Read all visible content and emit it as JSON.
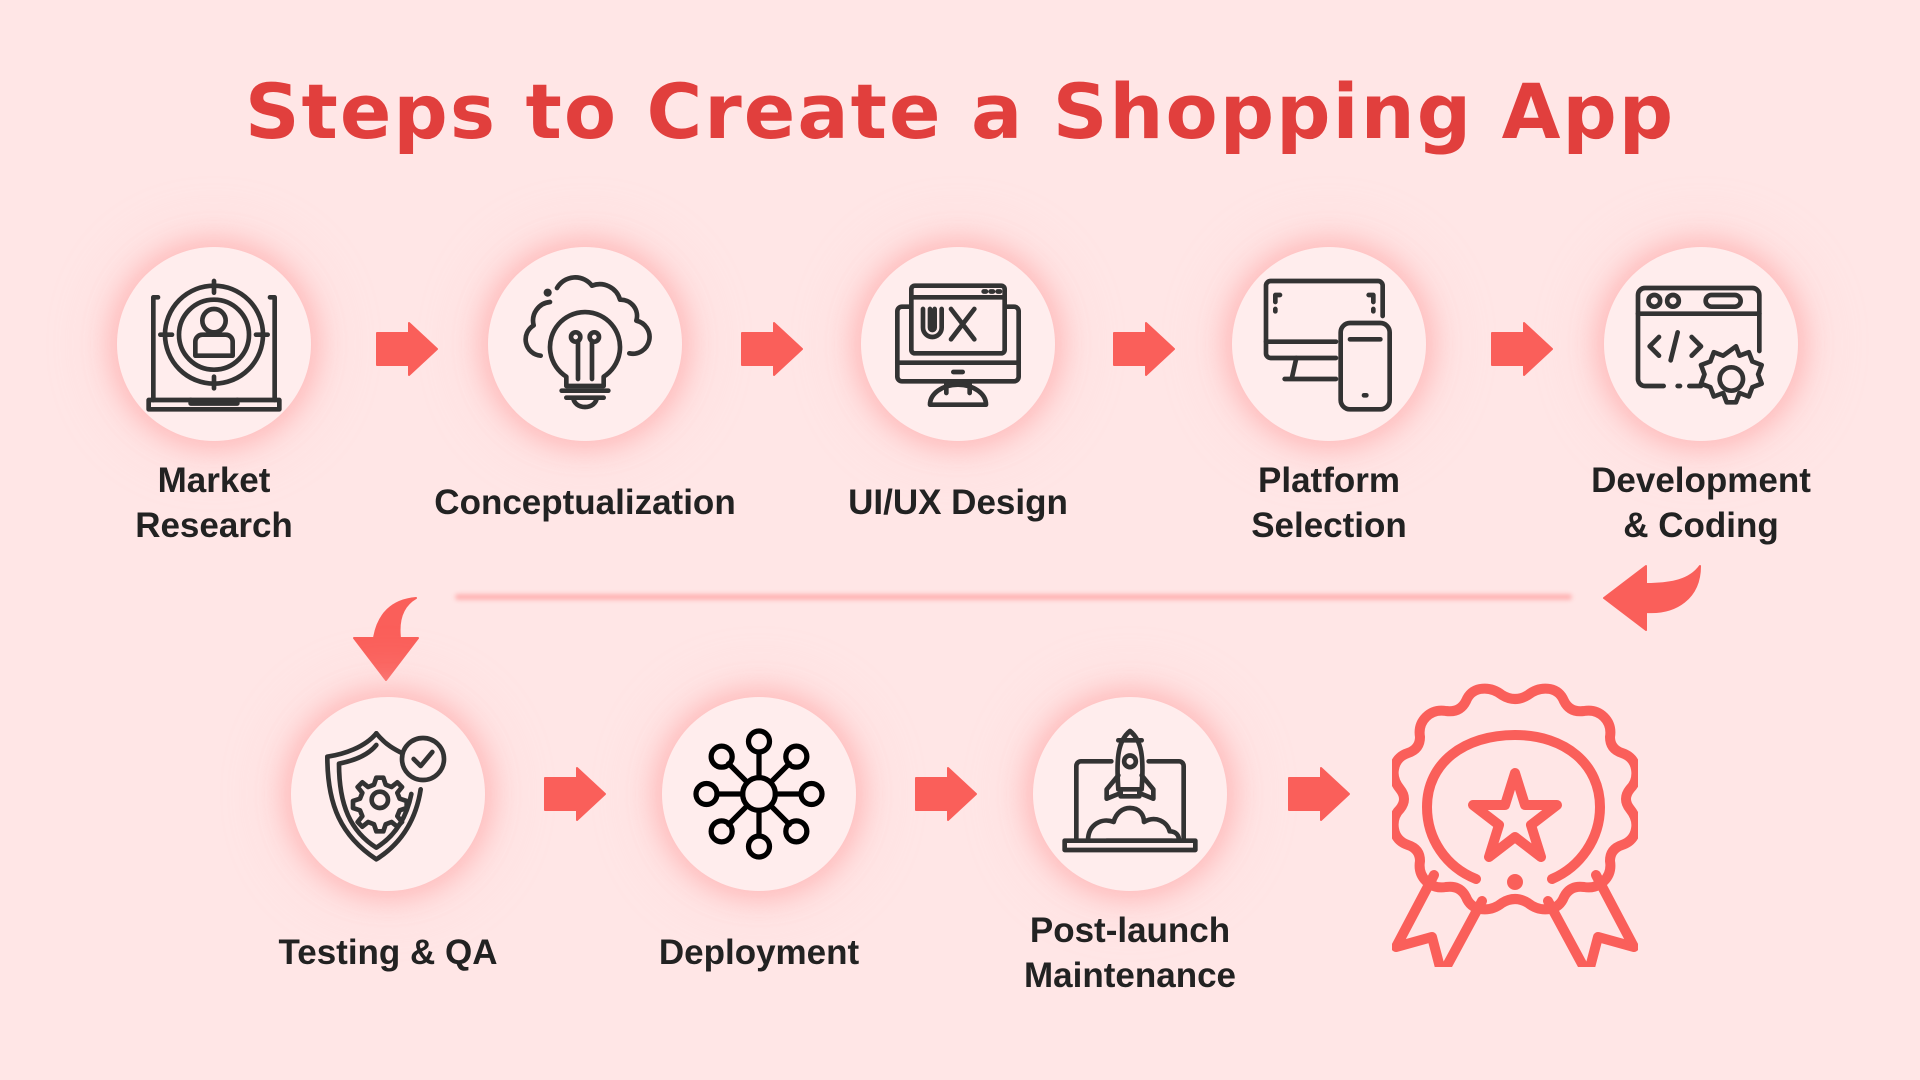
{
  "title": "Steps to Create a Shopping App",
  "colors": {
    "background": "#ffe6e6",
    "title": "#e13f3d",
    "accent": "#fa5f5a",
    "circle_fill": "#ffeded",
    "icon_stroke": "#333333",
    "label_text": "#222222",
    "connector_line": "#ffb3b3"
  },
  "steps": [
    {
      "label": "Market\nResearch",
      "icon": "laptop-target-user-icon"
    },
    {
      "label": "Conceptualization",
      "icon": "lightbulb-cloud-icon"
    },
    {
      "label": "UI/UX Design",
      "icon": "monitor-ux-icon"
    },
    {
      "label": "Platform\nSelection",
      "icon": "desktop-mobile-icon"
    },
    {
      "label": "Development\n& Coding",
      "icon": "browser-code-gear-icon"
    },
    {
      "label": "Testing & QA",
      "icon": "shield-gear-check-icon"
    },
    {
      "label": "Deployment",
      "icon": "network-hub-icon"
    },
    {
      "label": "Post-launch\nMaintenance",
      "icon": "laptop-rocket-icon"
    }
  ],
  "final": {
    "icon": "award-badge-star-icon"
  }
}
